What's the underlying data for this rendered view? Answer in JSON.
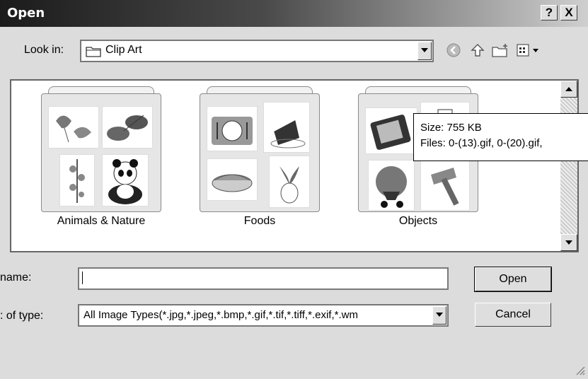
{
  "window": {
    "title": "Open",
    "help_label": "?",
    "close_label": "X"
  },
  "lookin": {
    "label": "Look in:",
    "value": "Clip Art"
  },
  "folders": [
    {
      "name": "Animals & Nature"
    },
    {
      "name": "Foods"
    },
    {
      "name": "Objects"
    }
  ],
  "tooltip": {
    "size": "Size: 755 KB",
    "files": "Files: 0-(13).gif, 0-(20).gif,"
  },
  "filename": {
    "label": "name:",
    "value": ""
  },
  "filetype": {
    "label": ": of type:",
    "value": "All Image Types(*.jpg,*.jpeg,*.bmp,*.gif,*.tif,*.tiff,*.exif,*.wm"
  },
  "buttons": {
    "open": "Open",
    "cancel": "Cancel"
  },
  "colors": {
    "title_gradient_start": "#1b1b1b",
    "title_gradient_end": "#cfcfcf",
    "dialog_bg": "#dcdcdc"
  }
}
